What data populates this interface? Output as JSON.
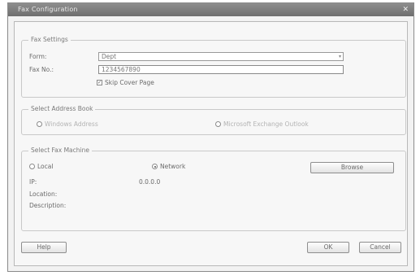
{
  "window": {
    "title": "Fax Configuration",
    "close_glyph": "✕"
  },
  "fax_settings": {
    "legend": "Fax Settings",
    "form_label": "Form:",
    "form_value": "Dept",
    "fax_no_label": "Fax No.:",
    "fax_no_value": "1234567890",
    "skip_cover_label": "Skip Cover Page",
    "skip_cover_checked": true
  },
  "address_book": {
    "legend": "Select Address Book",
    "option1": "Windows Address",
    "option2": "Microsoft Exchange Outlook"
  },
  "fax_machine": {
    "legend": "Select Fax Machine",
    "local_label": "Local",
    "network_label": "Network",
    "network_selected": true,
    "browse_label": "Browse",
    "ip_label": "IP:",
    "ip_value": "0.0.0.0",
    "location_label": "Location:",
    "description_label": "Description:"
  },
  "footer": {
    "help_label": "Help",
    "ok_label": "OK",
    "cancel_label": "Cancel"
  },
  "colors": {
    "titlebar": "#7e7e7e",
    "window_bg": "#f2f2f2"
  }
}
